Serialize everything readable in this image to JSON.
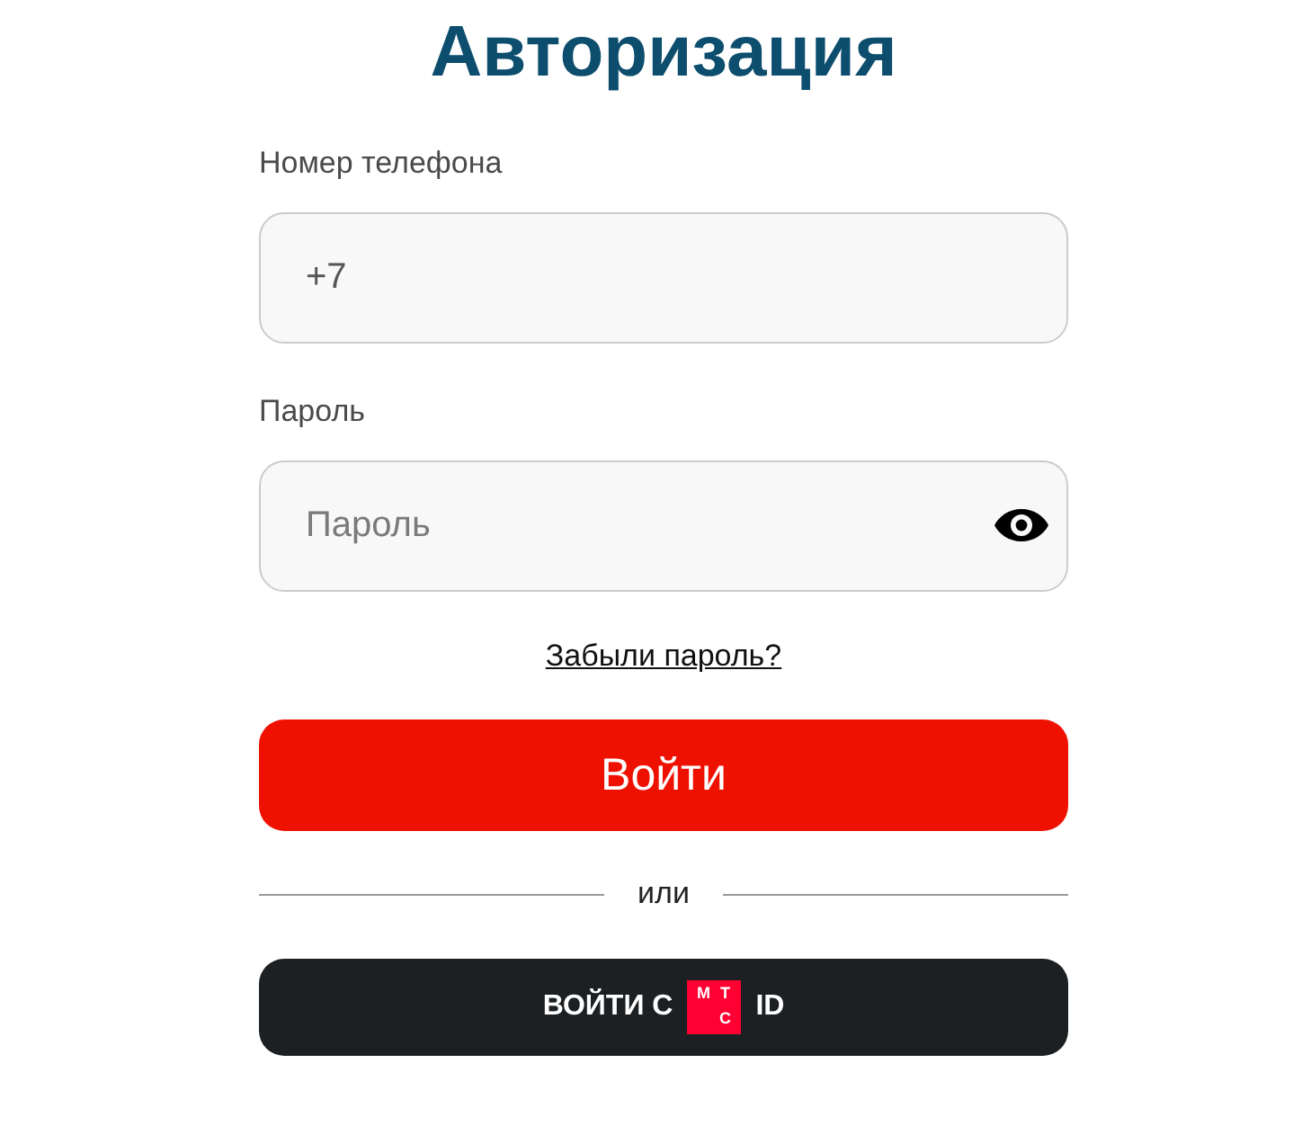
{
  "title": "Авторизация",
  "fields": [
    {
      "kind": "phone",
      "label": "Номер телефона",
      "value": "+7"
    },
    {
      "kind": "password",
      "label": "Пароль",
      "placeholder": "Пароль"
    }
  ],
  "forgot_link": "Забыли пароль?",
  "login_button": "Войти",
  "divider_text": "или",
  "mts_button": {
    "label_before": "ВОЙТИ С",
    "logo_letters": [
      "М",
      "Т",
      "С"
    ],
    "label_after": "ID"
  }
}
